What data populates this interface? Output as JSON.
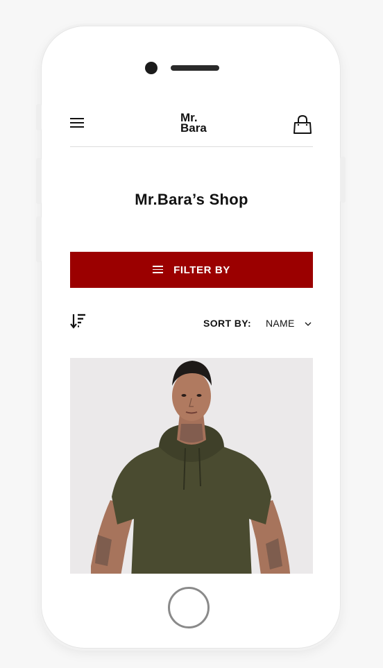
{
  "header": {
    "logo_line1": "Mr.",
    "logo_line2": "Bara",
    "menu_icon": "hamburger-menu-icon",
    "cart_icon": "shopping-bag-icon"
  },
  "page": {
    "title": "Mr.Bara’s Shop"
  },
  "filter": {
    "label": "FILTER BY",
    "icon": "filter-lines-icon",
    "color": "#9b0000"
  },
  "sort": {
    "icon": "sort-descending-icon",
    "label": "SORT BY:",
    "value": "NAME",
    "dropdown_icon": "chevron-down-icon"
  },
  "product": {
    "image": "model wearing olive green hooded t-shirt",
    "shirt_color": "#4a4b30"
  }
}
